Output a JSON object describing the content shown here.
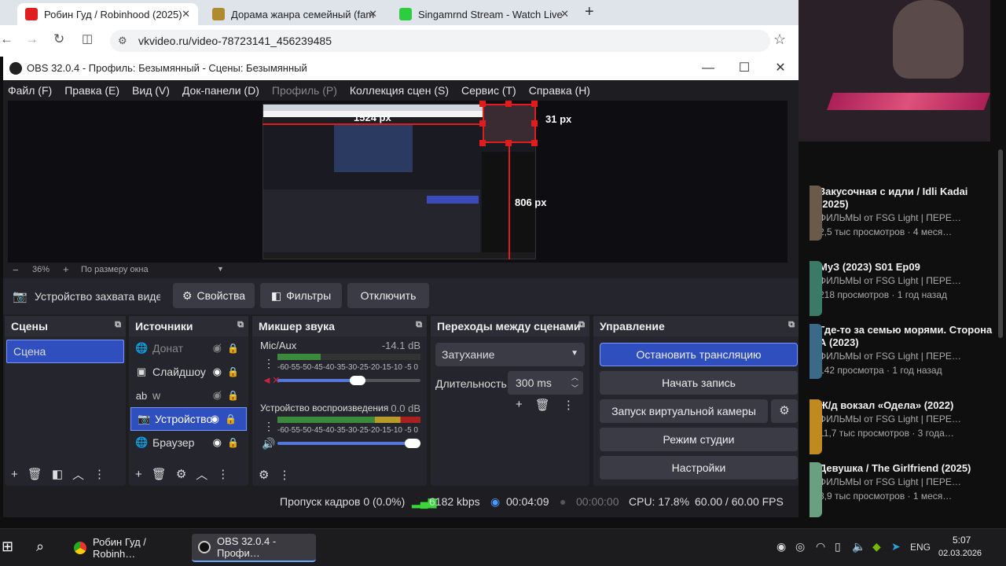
{
  "browser": {
    "tabs": [
      {
        "title": "Робин Гуд / Robinhood (2025)",
        "color": "#e02020"
      },
      {
        "title": "Дорама жанра семейный (fam",
        "color": "#b08a2e"
      },
      {
        "title": "Singamrnd Stream - Watch Live",
        "color": "#2ecc40"
      }
    ],
    "url": "vkvideo.ru/video-78723141_456239485"
  },
  "obs": {
    "title": "OBS 32.0.4 - Профиль: Безымянный - Сцены: Безымянный",
    "menu": [
      "Файл (F)",
      "Правка (E)",
      "Вид (V)",
      "Док-панели (D)",
      "Профиль (P)",
      "Коллекция сцен (S)",
      "Сервис (T)",
      "Справка (H)"
    ],
    "preview": {
      "width_label": "1524 px",
      "right_label": "31 px",
      "height_label": "806 px"
    },
    "zoom": {
      "minus": "−",
      "value": "36%",
      "plus": "+",
      "fit": "По размеру окна"
    },
    "context": {
      "source_name": "Устройство захвата видео",
      "properties": "Свойства",
      "filters": "Фильтры",
      "deactivate": "Отключить"
    },
    "docks": {
      "scenes": {
        "title": "Сцены",
        "items": [
          "Сцена"
        ]
      },
      "sources": {
        "title": "Источники",
        "items": [
          "Донат",
          "Слайдшоу",
          "w",
          "Устройство",
          "Браузер"
        ]
      },
      "mixer": {
        "title": "Микшер звука",
        "channels": [
          {
            "name": "Mic/Aux",
            "db": "-14.1 dB",
            "level": 0.3
          },
          {
            "name": "Устройство воспроизведения",
            "db": "0.0 dB",
            "level": 1.0
          }
        ],
        "scale": "-60-55-50-45-40-35-30-25-20-15-10 -5  0"
      },
      "transitions": {
        "title": "Переходы между сценами",
        "type": "Затухание",
        "duration_label": "Длительность",
        "duration": "300 ms"
      },
      "controls": {
        "title": "Управление",
        "buttons": [
          "Остановить трансляцию",
          "Начать запись",
          "Запуск виртуальной камеры",
          "Режим студии",
          "Настройки"
        ]
      }
    },
    "status": {
      "dropped": "Пропуск кадров 0 (0.0%)",
      "bitrate": "6182 kbps",
      "stream_time": "00:04:09",
      "rec_time": "00:00:00",
      "cpu": "CPU: 17.8%",
      "fps": "60.00 / 60.00 FPS"
    }
  },
  "sidebar": {
    "videos": [
      {
        "title": "Закусочная с идли / Idli Kadai (2025)",
        "channel": "ФИЛЬМЫ от FSG Light | ПЕРЕ…",
        "meta": "2,5 тыс просмотров · 4 меся…",
        "color": "#6a5a4a"
      },
      {
        "title": "МуЗ (2023) S01 Ep09",
        "channel": "ФИЛЬМЫ от FSG Light | ПЕРЕ…",
        "meta": "218 просмотров · 1 год назад",
        "color": "#3b7a66"
      },
      {
        "title": "Где-то за семью морями. Сторона А (2023)",
        "channel": "ФИЛЬМЫ от FSG Light | ПЕРЕ…",
        "meta": "142 просмотра · 1 год назад",
        "color": "#3a6a88"
      },
      {
        "title": "Ж/д вокзал «Одела» (2022)",
        "channel": "ФИЛЬМЫ от FSG Light | ПЕРЕ…",
        "meta": "11,7 тыс просмотров · 3 года…",
        "color": "#c08a20"
      },
      {
        "title": "Девушка / The Girlfriend (2025)",
        "channel": "ФИЛЬМЫ от FSG Light | ПЕРЕ…",
        "meta": "8,9 тыс просмотров · 1 меся…",
        "color": "#6aa080"
      }
    ]
  },
  "taskbar": {
    "apps": [
      "Робин Гуд / Robinh…",
      "OBS 32.0.4 - Профи…"
    ],
    "lang": "ENG",
    "time": "5:07",
    "date": "02.03.2026"
  }
}
